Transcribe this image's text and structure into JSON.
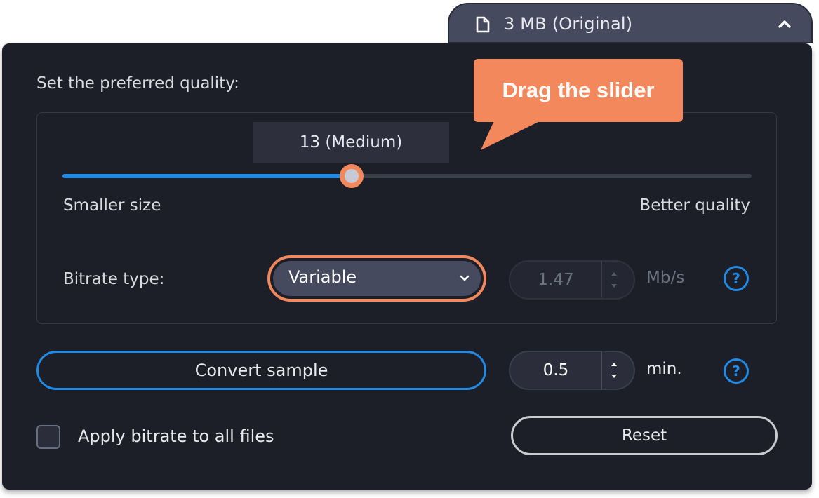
{
  "file_size": {
    "label": "3 MB (Original)"
  },
  "quality": {
    "title": "Set the preferred quality:",
    "value_label": "13 (Medium)",
    "slider_value_fraction": 0.42,
    "min_label": "Smaller size",
    "max_label": "Better quality"
  },
  "bitrate": {
    "label": "Bitrate type:",
    "selected": "Variable",
    "value": "1.47",
    "unit": "Mb/s"
  },
  "sample": {
    "button_label": "Convert sample",
    "value": "0.5",
    "unit": "min."
  },
  "apply_all": {
    "label": "Apply bitrate to all files",
    "checked": false
  },
  "reset": {
    "label": "Reset"
  },
  "help_glyph": "?",
  "callout": {
    "text": "Drag the slider"
  },
  "colors": {
    "panel": "#1d1f28",
    "accent": "#1f8be6",
    "highlight": "#f4885d",
    "pill": "#454a5e"
  },
  "icons": [
    "file-icon",
    "chevron-up-icon",
    "chevron-down-icon",
    "spin-up-icon",
    "spin-down-icon",
    "help-icon"
  ]
}
